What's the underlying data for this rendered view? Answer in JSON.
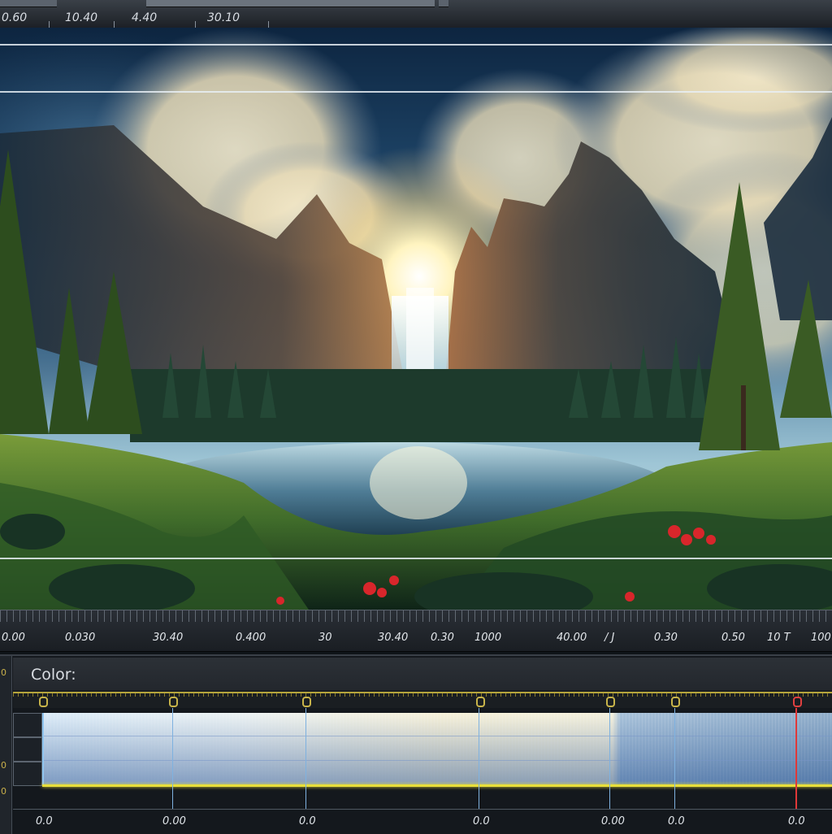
{
  "top_ruler": {
    "labels": [
      "0.60",
      "10.40",
      "4.40",
      "30.10"
    ]
  },
  "timeline_ruler": {
    "labels": [
      "0.00",
      "0.030",
      "30.40",
      "0.400",
      "30",
      "30.40",
      "0.30",
      "1000",
      "40.00",
      "/ J",
      "0.30",
      "0.50",
      "10 T",
      "100"
    ]
  },
  "color_panel": {
    "label": "Color:",
    "keyframe_labels": [
      "0",
      "0",
      "0",
      "0",
      "0",
      "0",
      "0"
    ],
    "bottom_labels": [
      "0.0",
      "0.00",
      "0.0",
      "0.0",
      "0.00",
      "0.0",
      "0.0"
    ],
    "side_glyphs": [
      "0",
      "0",
      "0"
    ],
    "accent_color": "#e8df3a",
    "keyframe_color": "#c8b44a",
    "active_keyframe_color": "#e04040"
  },
  "preview": {
    "icon": "landscape-image"
  }
}
